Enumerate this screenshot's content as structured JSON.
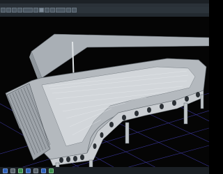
{
  "window": {
    "title": ""
  },
  "menubar": {
    "items": []
  },
  "toolbar": {
    "buttons": [
      "select-tool",
      "move-tool",
      "rotate-tool",
      "scale-tool",
      "render-tool",
      "view-tool"
    ]
  },
  "tabs": [],
  "viewport": {
    "label": ""
  },
  "statusbar": {
    "icons": [
      "status-icon-1",
      "status-icon-2",
      "status-icon-3"
    ]
  },
  "colors": {
    "background": "#000000",
    "grid": "#4a44c8",
    "model": "#c8ccd0",
    "ui": "#2c343b"
  }
}
